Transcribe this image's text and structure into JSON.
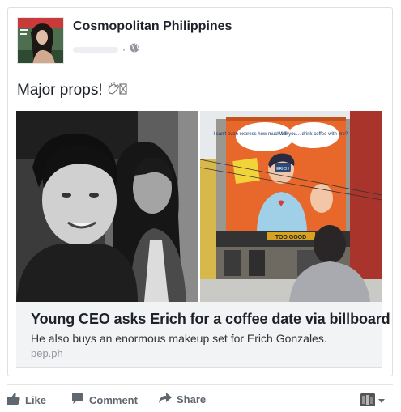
{
  "post": {
    "page_name": "Cosmopolitan Philippines",
    "privacy_icon": "globe-icon",
    "meta_separator": "·",
    "text": "Major props!"
  },
  "link_preview": {
    "title": "Young CEO asks Erich for a coffee date via billboard",
    "description": "He also buys an enormous makeup set for Erich Gonzales.",
    "domain": "pep.ph"
  },
  "billboard": {
    "bubble_left": "I can't even express how much I like you a latte.",
    "bubble_right": "Will you... drink coffee with me?",
    "cup_label": "ERICH",
    "storefront_left": "",
    "storefront_sign": "TOO GOOD"
  },
  "actions": {
    "like_label": "Like",
    "comment_label": "Comment",
    "share_label": "Share"
  },
  "colors": {
    "text": "#1d2129",
    "muted": "#606770",
    "link_bg": "#f2f3f5",
    "billboard": "#e8682c"
  }
}
